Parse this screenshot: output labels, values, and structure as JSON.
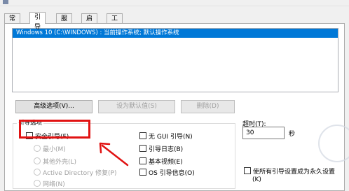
{
  "tabs": [
    "常规",
    "引导",
    "服务",
    "启动",
    "工具"
  ],
  "os_list": [
    "Windows 10 (C:\\WINDOWS) : 当前操作系统; 默认操作系统"
  ],
  "buttons": {
    "advanced": "高级选项(V)...",
    "set_default": "设为默认值(S)",
    "delete": "删除(D)"
  },
  "boot_options": {
    "group_label": "引导选项",
    "safe_boot": "安全引导(F)",
    "minimal": "最小(M)",
    "alternate_shell": "其他外壳(L)",
    "ad_repair": "Active Directory 修复(P)",
    "network": "网络(N)",
    "no_gui_boot": "无 GUI 引导(N)",
    "boot_log": "引导日志(B)",
    "base_video": "基本视频(E)",
    "os_boot_info": "OS 引导信息(O)"
  },
  "timeout": {
    "label": "超时(T):",
    "value": "30",
    "unit": "秒",
    "permanent": "使所有引导设置成为永久设置",
    "permanent_suffix": "(K)"
  },
  "colors": {
    "selection": "#0078d7",
    "annotation": "#e11212"
  }
}
